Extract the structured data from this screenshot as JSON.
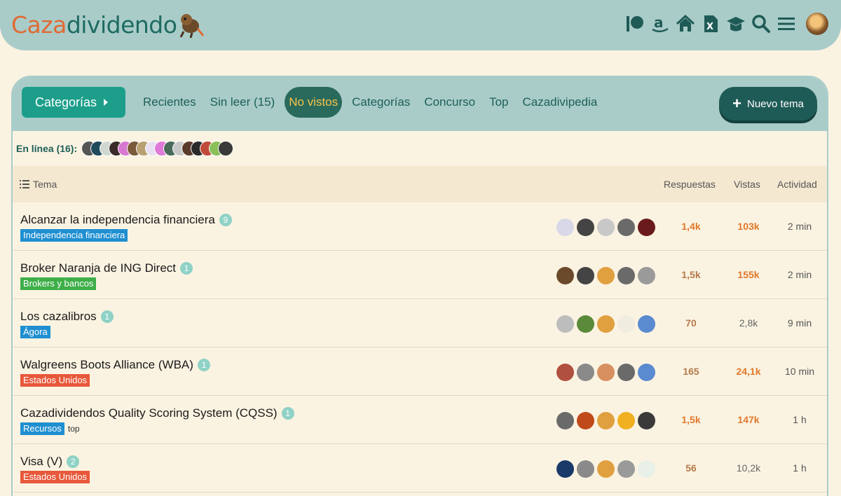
{
  "brand": {
    "part1": "Caza",
    "part2": "dividendo"
  },
  "colors": {
    "accent": "#1c9e8a",
    "header": "#a9ccc9",
    "background": "#fbf3e2",
    "hot": "#e0782a"
  },
  "header_icons": [
    "patreon-icon",
    "amazon-icon",
    "home-icon",
    "excel-icon",
    "graduation-cap-icon",
    "search-icon",
    "hamburger-menu-icon",
    "user-avatar"
  ],
  "nav": {
    "categories_button": "Categorías",
    "links": [
      {
        "label": "Recientes",
        "active": false
      },
      {
        "label": "Sin leer (15)",
        "active": false
      },
      {
        "label": "No vistos",
        "active": true
      },
      {
        "label": "Categorías",
        "active": false
      },
      {
        "label": "Concurso",
        "active": false
      },
      {
        "label": "Top",
        "active": false
      },
      {
        "label": "Cazadivipedia",
        "active": false
      }
    ],
    "new_topic": "Nuevo tema"
  },
  "online": {
    "label": "En línea (16):"
  },
  "columns": {
    "topic": "Tema",
    "replies": "Respuestas",
    "views": "Vistas",
    "activity": "Actividad"
  },
  "topics": [
    {
      "title": "Alcanzar la independencia financiera",
      "count": "9",
      "category": "Independencia financiera",
      "category_color": "#1f8fd1",
      "tag": "",
      "replies": "1,4k",
      "views": "103k",
      "activity": "2 min",
      "replies_heat": "hot",
      "views_heat": "hot"
    },
    {
      "title": "Broker Naranja de ING Direct",
      "count": "1",
      "category": "Brokers y bancos",
      "category_color": "#3fae49",
      "tag": "",
      "replies": "1,5k",
      "views": "155k",
      "activity": "2 min",
      "replies_heat": "warm",
      "views_heat": "hot"
    },
    {
      "title": "Los cazalibros",
      "count": "1",
      "category": "Ágora",
      "category_color": "#1f8fd1",
      "tag": "",
      "replies": "70",
      "views": "2,8k",
      "activity": "9 min",
      "replies_heat": "warm",
      "views_heat": "cool"
    },
    {
      "title": "Walgreens Boots Alliance (WBA)",
      "count": "1",
      "category": "Estados Unidos",
      "category_color": "#e8583a",
      "tag": "",
      "replies": "165",
      "views": "24,1k",
      "activity": "10 min",
      "replies_heat": "warm",
      "views_heat": "hot"
    },
    {
      "title": "Cazadividendos Quality Scoring System (CQSS)",
      "count": "1",
      "category": "Recursos",
      "category_color": "#1f8fd1",
      "tag": "top",
      "replies": "1,5k",
      "views": "147k",
      "activity": "1 h",
      "replies_heat": "hot",
      "views_heat": "hot"
    },
    {
      "title": "Visa (V)",
      "count": "2",
      "category": "Estados Unidos",
      "category_color": "#e8583a",
      "tag": "",
      "replies": "56",
      "views": "10,2k",
      "activity": "1 h",
      "replies_heat": "warm",
      "views_heat": "cool"
    }
  ]
}
